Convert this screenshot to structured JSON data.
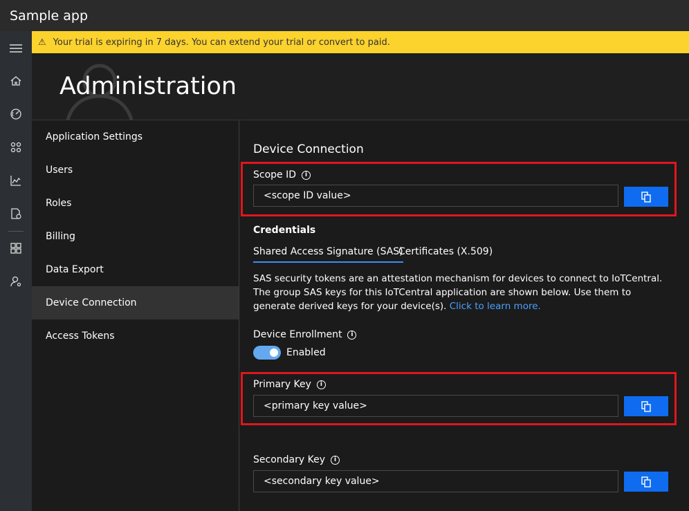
{
  "app": {
    "title": "Sample app"
  },
  "rail": {
    "icons": [
      "menu-icon",
      "home-icon",
      "dashboard-icon",
      "devices-icon",
      "analytics-icon",
      "jobs-icon",
      "device-templates-icon",
      "administration-icon"
    ]
  },
  "banner": {
    "text": "Your trial is expiring in 7 days. You can extend your trial or convert to paid."
  },
  "page": {
    "title": "Administration"
  },
  "nav": {
    "items": [
      {
        "label": "Application Settings"
      },
      {
        "label": "Users"
      },
      {
        "label": "Roles"
      },
      {
        "label": "Billing"
      },
      {
        "label": "Data Export"
      },
      {
        "label": "Device Connection"
      },
      {
        "label": "Access Tokens"
      }
    ],
    "active": "Device Connection"
  },
  "main": {
    "heading": "Device Connection",
    "scope": {
      "label": "Scope ID",
      "value": "<scope ID value>"
    },
    "credentials": {
      "heading": "Credentials",
      "tabs": [
        {
          "label": "Shared Access Signature (SAS)"
        },
        {
          "label": "Certificates (X.509)"
        }
      ],
      "description": "SAS security tokens are an attestation mechanism for devices to connect to IoTCentral. The group SAS keys for this IoTCentral application are shown below. Use them to generate derived keys for your device(s).",
      "link": "Click to learn more."
    },
    "enrollment": {
      "label": "Device Enrollment",
      "state": "Enabled"
    },
    "primary": {
      "label": "Primary Key",
      "value": "<primary key value>"
    },
    "secondary": {
      "label": "Secondary Key",
      "value": "<secondary key value>"
    }
  },
  "colors": {
    "accent": "#0f6cf0",
    "highlight": "#e0161d",
    "banner": "#fcd22d"
  }
}
